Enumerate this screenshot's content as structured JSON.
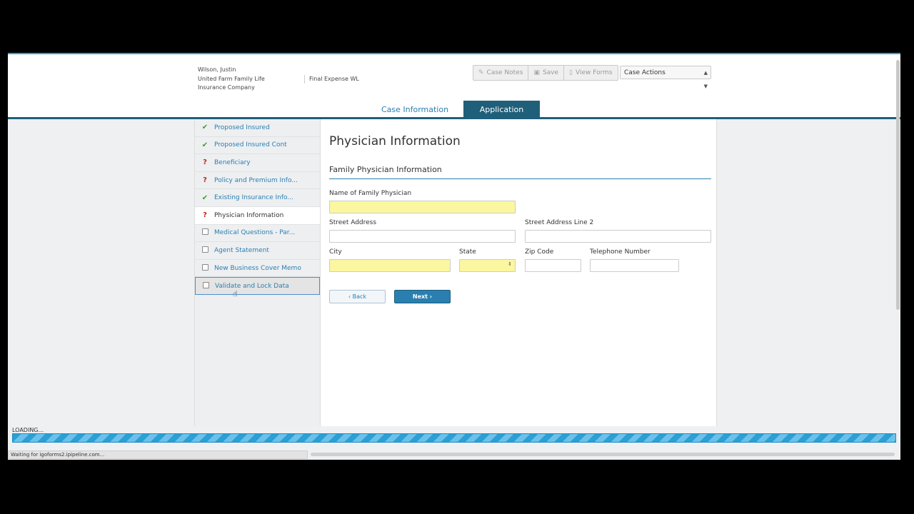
{
  "header": {
    "client_name": "Wilson, Justin",
    "company": "United Farm Family Life Insurance Company",
    "product": "Final Expense WL"
  },
  "toolbar": {
    "case_notes_label": "Case Notes",
    "save_label": "Save",
    "view_forms_label": "View Forms",
    "case_actions_value": "Case Actions"
  },
  "tabs": {
    "case_info": "Case Information",
    "application": "Application"
  },
  "sidebar": {
    "items": [
      {
        "label": "Proposed Insured",
        "status": "complete"
      },
      {
        "label": "Proposed Insured Cont",
        "status": "complete"
      },
      {
        "label": "Beneficiary",
        "status": "incomplete"
      },
      {
        "label": "Policy and Premium Info...",
        "status": "incomplete"
      },
      {
        "label": "Existing Insurance Info...",
        "status": "complete"
      },
      {
        "label": "Physician Information",
        "status": "incomplete"
      },
      {
        "label": "Medical Questions - Par...",
        "status": "not-started"
      },
      {
        "label": "Agent Statement",
        "status": "not-started"
      },
      {
        "label": "New Business Cover Memo",
        "status": "not-started"
      },
      {
        "label": "Validate and Lock Data",
        "status": "not-started"
      }
    ]
  },
  "form": {
    "page_title": "Physician Information",
    "section_title": "Family Physician Information",
    "physician_name_label": "Name of Family Physician",
    "street_label": "Street Address",
    "street2_label": "Street Address Line 2",
    "city_label": "City",
    "state_label": "State",
    "zip_label": "Zip Code",
    "phone_label": "Telephone Number",
    "back_label": "Back",
    "next_label": "Next"
  },
  "status": {
    "loading_text": "LOADING...",
    "statusbar_text": "Waiting for igoforms2.ipipeline.com..."
  },
  "colors": {
    "accent": "#2a7fb0",
    "tab_active": "#1f5f7a",
    "required_field": "#fbf7a0"
  }
}
